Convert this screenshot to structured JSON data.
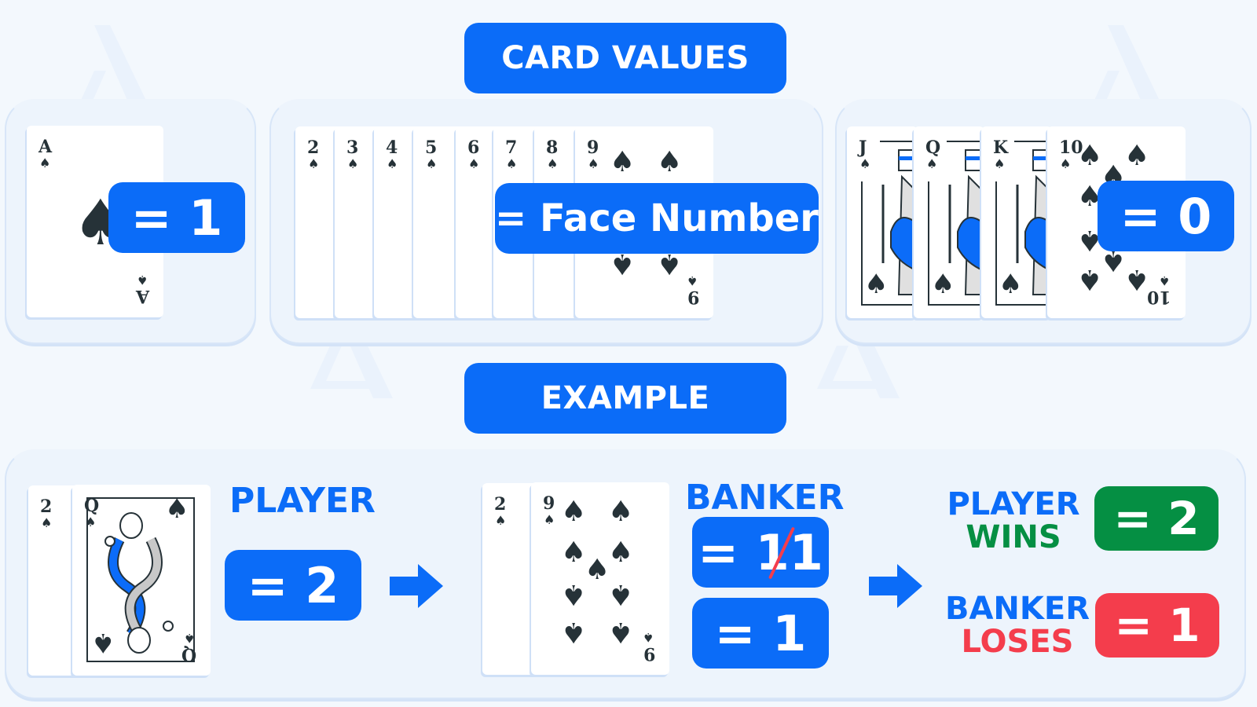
{
  "sections": {
    "card_values_title": "CARD VALUES",
    "example_title": "EXAMPLE"
  },
  "colors": {
    "accent_blue": "#0b6cf8",
    "win_green": "#058f43",
    "lose_red": "#f43d4c",
    "background": "#f3f8fd",
    "panel": "#edf4fc",
    "card_ink": "#263238"
  },
  "card_values": {
    "ace_group": {
      "cards": [
        {
          "rank": "A",
          "suit": "♠"
        }
      ],
      "value_label": "= 1"
    },
    "number_group": {
      "cards": [
        {
          "rank": "2",
          "suit": "♠"
        },
        {
          "rank": "3",
          "suit": "♠"
        },
        {
          "rank": "4",
          "suit": "♠"
        },
        {
          "rank": "5",
          "suit": "♠"
        },
        {
          "rank": "6",
          "suit": "♠"
        },
        {
          "rank": "7",
          "suit": "♠"
        },
        {
          "rank": "8",
          "suit": "♠"
        },
        {
          "rank": "9",
          "suit": "♠"
        }
      ],
      "value_label": "= Face Number"
    },
    "face_group": {
      "cards": [
        {
          "rank": "J",
          "suit": "♠"
        },
        {
          "rank": "Q",
          "suit": "♠"
        },
        {
          "rank": "K",
          "suit": "♠"
        },
        {
          "rank": "10",
          "suit": "♠"
        }
      ],
      "value_label": "= 0"
    }
  },
  "example": {
    "player": {
      "label": "PLAYER",
      "cards": [
        {
          "rank": "2",
          "suit": "♠"
        },
        {
          "rank": "Q",
          "suit": "♠"
        }
      ],
      "total": "= 2"
    },
    "banker": {
      "label": "BANKER",
      "cards": [
        {
          "rank": "2",
          "suit": "♠"
        },
        {
          "rank": "9",
          "suit": "♠"
        }
      ],
      "raw_total_prefix": "= 1",
      "raw_total_struck_digit": "1",
      "final_total": "= 1"
    },
    "result": {
      "player_line1": "PLAYER",
      "player_line2": "WINS",
      "player_value": "= 2",
      "banker_line1": "BANKER",
      "banker_line2": "LOSES",
      "banker_value": "= 1"
    }
  }
}
